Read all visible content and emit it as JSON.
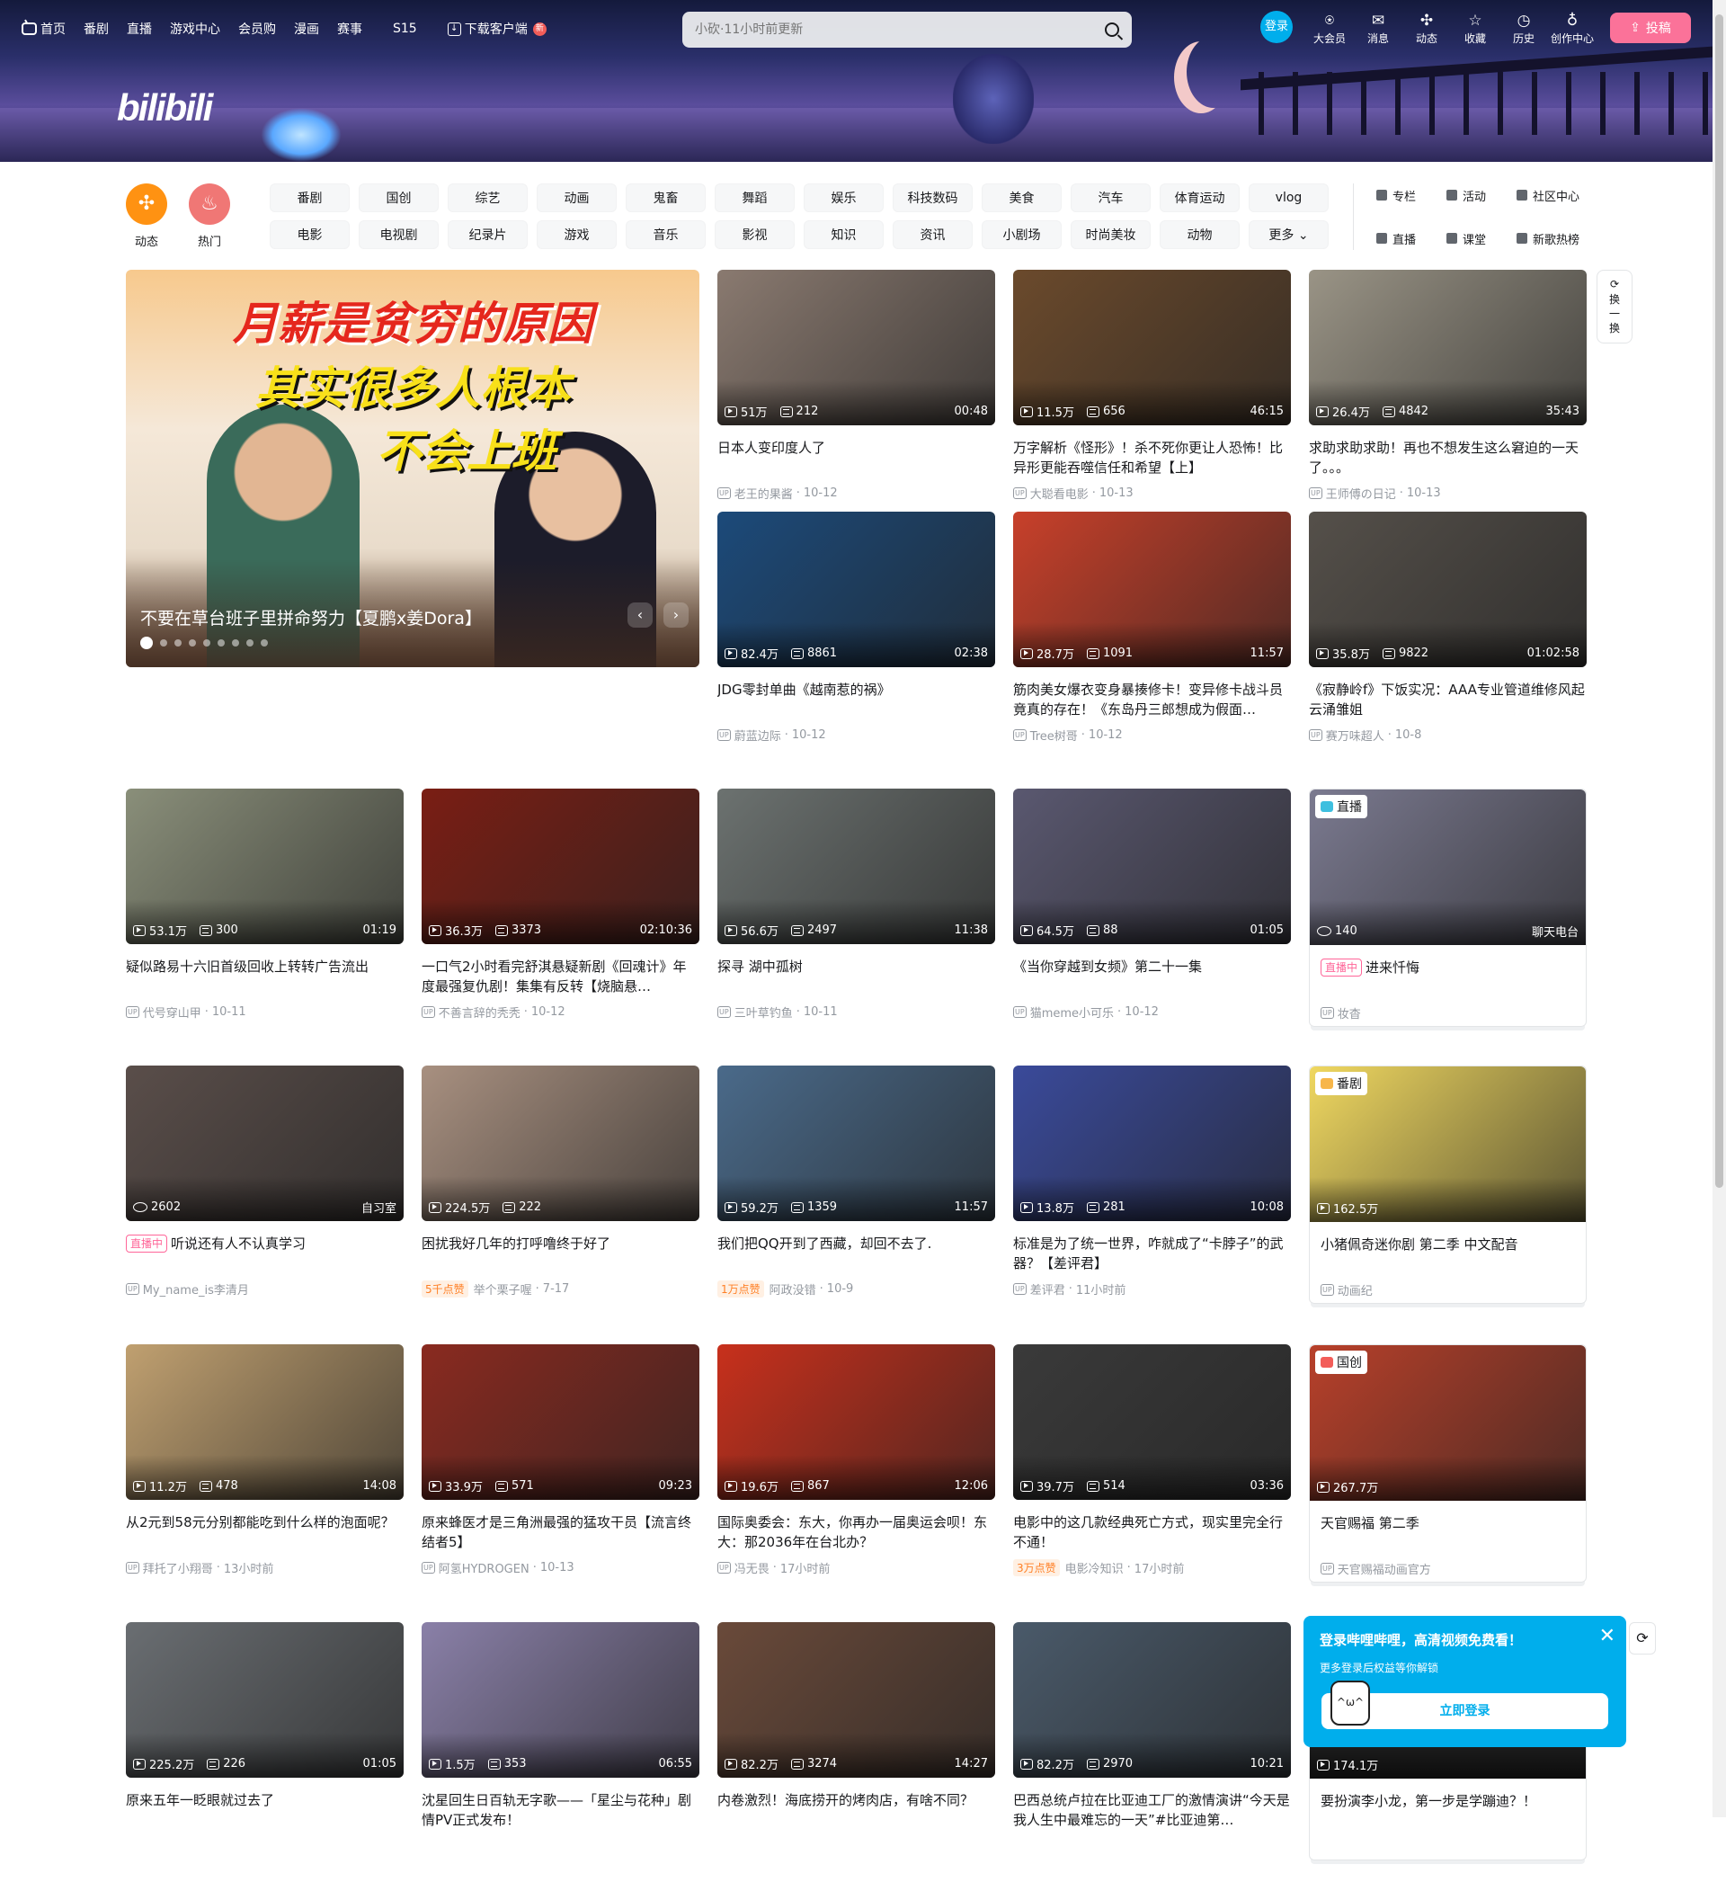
{
  "header": {
    "nav": [
      {
        "label": "首页",
        "icon": "tv-icon"
      },
      {
        "label": "番剧"
      },
      {
        "label": "直播"
      },
      {
        "label": "游戏中心"
      },
      {
        "label": "会员购"
      },
      {
        "label": "漫画"
      },
      {
        "label": "赛事"
      },
      {
        "label": "S15"
      },
      {
        "label": "下载客户端",
        "icon": "download-icon",
        "badge": "新"
      }
    ],
    "logo": "bilibili",
    "search_placeholder": "小砍·11小时前更新",
    "login": "登录",
    "right": [
      {
        "label": "大会员",
        "icon": "⍟"
      },
      {
        "label": "消息",
        "icon": "✉"
      },
      {
        "label": "动态",
        "icon": "✣"
      },
      {
        "label": "收藏",
        "icon": "☆"
      },
      {
        "label": "历史",
        "icon": "◷"
      },
      {
        "label": "创作中心",
        "icon": "♁"
      }
    ],
    "upload": "投稿"
  },
  "channels": {
    "dynamic": "动态",
    "hot": "热门",
    "items": [
      "番剧",
      "国创",
      "综艺",
      "动画",
      "鬼畜",
      "舞蹈",
      "娱乐",
      "科技数码",
      "美食",
      "汽车",
      "体育运动",
      "vlog",
      "电影",
      "电视剧",
      "纪录片",
      "游戏",
      "音乐",
      "影视",
      "知识",
      "资讯",
      "小剧场",
      "时尚美妆",
      "动物",
      "更多 ⌄"
    ],
    "links": [
      "专栏",
      "活动",
      "社区中心",
      "直播",
      "课堂",
      "新歌热榜"
    ]
  },
  "carousel": {
    "title": "不要在草台班子里拼命努力【夏鹏x姜Dora】",
    "image_text": [
      "月薪是贫穷的原因",
      "其实很多人根本",
      "不会上班"
    ],
    "dots": 9,
    "active": 0,
    "prev": "‹",
    "next": "›"
  },
  "refresh": {
    "icon": "⟳",
    "label": "换一换"
  },
  "cards": [
    {
      "views": "51万",
      "danmaku": "212",
      "duration": "00:48",
      "title": "日本人变印度人了",
      "author": "老王的果酱",
      "date": "10-12",
      "color": "#8a7a70"
    },
    {
      "views": "11.5万",
      "danmaku": "656",
      "duration": "46:15",
      "title": "万字解析《怪形》！杀不死你更让人恐怖！比异形更能吞噬信任和希望【上】",
      "author": "大聪看电影",
      "date": "10-13",
      "color": "#6b4a2c"
    },
    {
      "views": "26.4万",
      "danmaku": "4842",
      "duration": "35:43",
      "title": "求助求助求助！再也不想发生这么窘迫的一天了。。。",
      "author": "王师傅の日记",
      "date": "10-13",
      "color": "#9a9486"
    },
    {
      "views": "82.4万",
      "danmaku": "8861",
      "duration": "02:38",
      "title": "JDG零封单曲《越南惹的祸》",
      "author": "蔚蓝边际",
      "date": "10-12",
      "color": "#1c4a7a"
    },
    {
      "views": "28.7万",
      "danmaku": "1091",
      "duration": "11:57",
      "title": "筋肉美女爆衣变身暴揍修卡！变异修卡战斗员竟真的存在！《东岛丹三郎想成为假面…",
      "author": "Tree树哥",
      "date": "10-12",
      "color": "#c8402a"
    },
    {
      "views": "35.8万",
      "danmaku": "9822",
      "duration": "01:02:58",
      "title": "《寂静岭f》下饭实况：AAA专业管道维修风起云涌雏姐",
      "author": "赛万味超人",
      "date": "10-8",
      "color": "#55504a"
    },
    {
      "views": "53.1万",
      "danmaku": "300",
      "duration": "01:19",
      "title": "疑似路易十六旧首级回收上转转广告流出",
      "author": "代号穿山甲",
      "date": "10-11",
      "color": "#8a8f7a"
    },
    {
      "views": "36.3万",
      "danmaku": "3373",
      "duration": "02:10:36",
      "title": "一口气2小时看完舒淇悬疑新剧《回魂计》年度最强复仇剧！集集有反转【烧脑悬…",
      "author": "不善言辞的秃秃",
      "date": "10-12",
      "color": "#7a1e14"
    },
    {
      "views": "56.6万",
      "danmaku": "2497",
      "duration": "11:38",
      "title": "探寻 湖中孤树",
      "author": "三叶草钓鱼",
      "date": "10-11",
      "color": "#6c7270"
    },
    {
      "views": "64.5万",
      "danmaku": "88",
      "duration": "01:05",
      "title": "《当你穿越到女频》第二十一集",
      "author": "猫meme小可乐",
      "date": "10-12",
      "color": "#5a5870"
    },
    {
      "special": true,
      "badge": "直播",
      "badge_color": "#3fbfdf",
      "live_viewers": "140",
      "area": "聊天电台",
      "live_tag": "直播中",
      "title": "进来忏悔",
      "author": "妆杳",
      "color": "#7b7a90"
    },
    {
      "live_viewers": "2602",
      "area": "自习室",
      "live_tag": "直播中",
      "title": "听说还有人不认真学习",
      "author": "My_name_is李清月",
      "color": "#5a4e4a"
    },
    {
      "views": "224.5万",
      "danmaku": "222",
      "title": "困扰我好几年的打呼噜终于好了",
      "likes": "5千点赞",
      "author": "举个栗子喔",
      "date": "7-17",
      "color": "#a89080"
    },
    {
      "views": "59.2万",
      "danmaku": "1359",
      "duration": "11:57",
      "title": "我们把QQ开到了西藏，却回不去了.",
      "likes": "1万点赞",
      "author": "阿政没错",
      "date": "10-9",
      "color": "#4a6a8a"
    },
    {
      "views": "13.8万",
      "danmaku": "281",
      "duration": "10:08",
      "title": "标准是为了统一世界，咋就成了“卡脖子”的武器？【差评君】",
      "author": "差评君",
      "date": "11小时前",
      "color": "#3a4a9a"
    },
    {
      "special": true,
      "badge": "番剧",
      "badge_color": "#f7b64a",
      "views": "162.5万",
      "title": "小猪佩奇迷你剧 第二季 中文配音",
      "author": "动画纪",
      "color": "#f0d860"
    },
    {
      "views": "11.2万",
      "danmaku": "478",
      "duration": "14:08",
      "title": "从2元到58元分别都能吃到什么样的泡面呢？",
      "author": "拜托了小翔哥",
      "date": "13小时前",
      "color": "#c0a070"
    },
    {
      "views": "33.9万",
      "danmaku": "571",
      "duration": "09:23",
      "title": "原来蜂医才是三角洲最强的猛攻干员【流言终结者5】",
      "author": "阿氢HYDROGEN",
      "date": "10-13",
      "color": "#8a2a20"
    },
    {
      "views": "19.6万",
      "danmaku": "867",
      "duration": "12:06",
      "title": "国际奥委会：东大，你再办一届奥运会呗！东大：那2036年在台北办？",
      "author": "冯无畏",
      "date": "17小时前",
      "color": "#c8301c"
    },
    {
      "views": "39.7万",
      "danmaku": "514",
      "duration": "03:36",
      "title": "电影中的这几款经典死亡方式，现实里完全行不通！",
      "likes": "3万点赞",
      "author": "电影冷知识",
      "date": "17小时前",
      "color": "#3a3a3a"
    },
    {
      "special": true,
      "badge": "国创",
      "badge_color": "#f25d59",
      "views": "267.7万",
      "title": "天官赐福 第二季",
      "author": "天官赐福动画官方",
      "color": "#b8402a"
    },
    {
      "views": "225.2万",
      "danmaku": "226",
      "duration": "01:05",
      "title": "原来五年一眨眼就过去了",
      "color": "#6a6e72"
    },
    {
      "views": "1.5万",
      "danmaku": "353",
      "duration": "06:55",
      "title": "沈星回生日百轨无字歌——「星尘与花种」剧情PV正式发布！",
      "color": "#8a80a8"
    },
    {
      "views": "82.2万",
      "danmaku": "3274",
      "duration": "14:27",
      "title": "内卷激烈！海底捞开的烤肉店，有啥不同？",
      "color": "#6a4a3a"
    },
    {
      "views": "82.2万",
      "danmaku": "2970",
      "duration": "10:21",
      "title": "巴西总统卢拉在比亚迪工厂的激情演讲“今天是我人生中最难忘的一天”#比亚迪第…",
      "color": "#4a5a6a"
    },
    {
      "special": true,
      "views": "174.1万",
      "title": "要扮演李小龙，第一步是学蹦迪？！",
      "color": "#222222"
    }
  ],
  "popup": {
    "title": "登录哔哩哔哩，高清视频免费看！",
    "subtitle": "更多登录后权益等你解锁",
    "button": "立即登录",
    "close": "✕"
  },
  "colors": {
    "accent": "#00aeec",
    "pink": "#fb7299"
  }
}
